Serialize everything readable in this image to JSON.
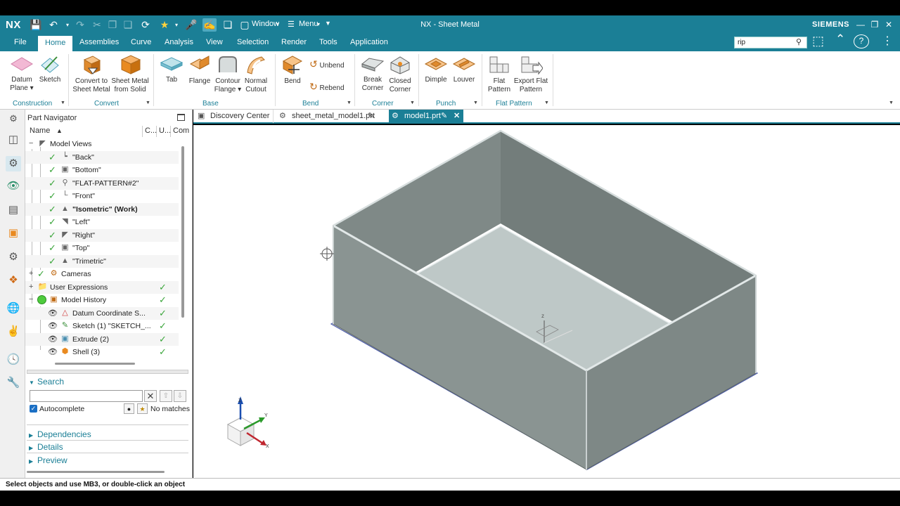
{
  "title_bar": {
    "logo": "NX",
    "window_menu": "Window",
    "menu_button": "Menu",
    "document_title": "NX - Sheet Metal",
    "brand": "SIEMENS"
  },
  "menu_tabs": [
    "File",
    "Home",
    "Assemblies",
    "Curve",
    "Analysis",
    "View",
    "Selection",
    "Render",
    "Tools",
    "Application"
  ],
  "command_search": {
    "value": "rip"
  },
  "ribbon": {
    "construction": {
      "label": "Construction",
      "datum_plane": "Datum Plane",
      "sketch": "Sketch"
    },
    "convert": {
      "label": "Convert",
      "convert_to_sheet_metal": "Convert to Sheet Metal",
      "sheet_metal_from_solid": "Sheet Metal from Solid"
    },
    "base": {
      "label": "Base",
      "tab": "Tab",
      "flange": "Flange",
      "contour_flange": "Contour Flange",
      "normal_cutout": "Normal Cutout"
    },
    "bend": {
      "label": "Bend",
      "bend": "Bend",
      "unbend": "Unbend",
      "rebend": "Rebend"
    },
    "corner": {
      "label": "Corner",
      "break_corner": "Break Corner",
      "closed_corner": "Closed Corner"
    },
    "punch": {
      "label": "Punch",
      "dimple": "Dimple",
      "louver": "Louver"
    },
    "flat_pattern": {
      "label": "Flat Pattern",
      "flat_pattern": "Flat Pattern",
      "export_flat_pattern": "Export Flat Pattern"
    }
  },
  "navigator": {
    "title": "Part Navigator",
    "columns": [
      "Name",
      "C...",
      "U...",
      "Com"
    ],
    "tree": {
      "model_views": "Model Views",
      "views": [
        "\"Back\"",
        "\"Bottom\"",
        "\"FLAT-PATTERN#2\"",
        "\"Front\"",
        "\"Isometric\" (Work)",
        "\"Left\"",
        "\"Right\"",
        "\"Top\"",
        "\"Trimetric\""
      ],
      "cameras": "Cameras",
      "user_expressions": "User Expressions",
      "model_history": "Model History",
      "features": [
        "Datum Coordinate S...",
        "Sketch (1) \"SKETCH_...",
        "Extrude (2)",
        "Shell (3)"
      ]
    },
    "search": {
      "title": "Search",
      "autocomplete": "Autocomplete",
      "no_matches": "No matches"
    },
    "dependencies": "Dependencies",
    "details": "Details",
    "preview": "Preview"
  },
  "doc_tabs": [
    "Discovery Center",
    "sheet_metal_model1.prt",
    "model1.prt"
  ],
  "triad": {
    "x": "X",
    "y": "Y",
    "z": "Z"
  },
  "status_bar": "Select objects and use MB3, or double-click an object",
  "colors": {
    "accent": "#1b7f96",
    "model_face_dark": "#7d8684",
    "model_face_light": "#b9c3c2",
    "check_green": "#3aa53a"
  }
}
